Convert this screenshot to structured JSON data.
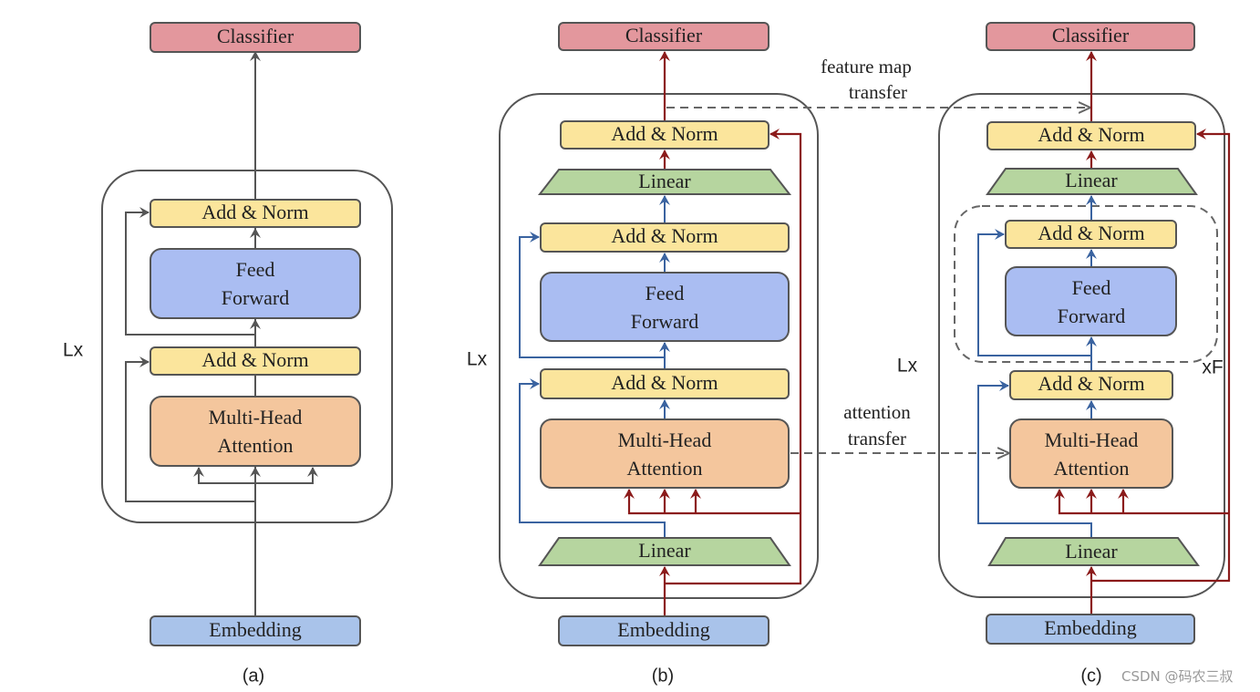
{
  "labels": {
    "classifier": "Classifier",
    "add_norm": "Add & Norm",
    "feed": "Feed",
    "forward": "Forward",
    "multi_head": "Multi-Head",
    "attention": "Attention",
    "embedding": "Embedding",
    "linear": "Linear",
    "lx": "Lx",
    "xf": "xF"
  },
  "annotations": {
    "feature_map_1": "feature map",
    "feature_map_2": "transfer",
    "attention_transfer_1": "attention",
    "attention_transfer_2": "transfer"
  },
  "captions": {
    "a": "(a)",
    "b": "(b)",
    "c": "(c)"
  },
  "watermark": "CSDN @码农三叔",
  "colors": {
    "classifier": "#e3979d",
    "add_norm": "#fbe59c",
    "feed_forward": "#aabdf2",
    "attention": "#f4c69d",
    "linear": "#b6d59f",
    "embedding": "#a9c3ea",
    "red_path": "#8b1a1a",
    "blue_path": "#3a63a0",
    "gray_path": "#555555"
  }
}
